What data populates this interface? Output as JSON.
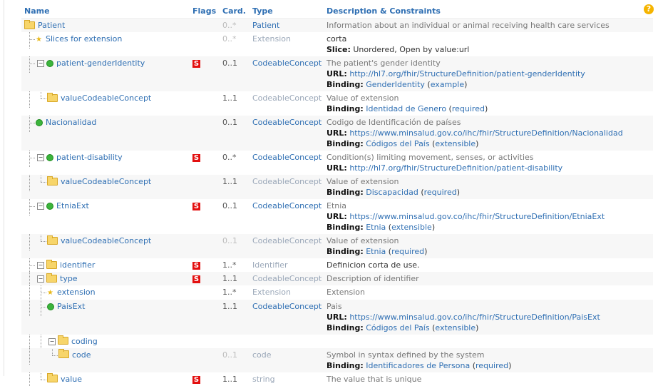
{
  "header": {
    "name": "Name",
    "flags": "Flags",
    "card": "Card.",
    "type": "Type",
    "desc": "Description & Constraints",
    "help_glyph": "?"
  },
  "rows": [
    {
      "name": "Patient",
      "flag": "",
      "card": "0..*",
      "type": "Patient",
      "desc": "Information about an individual or animal receiving health care services"
    },
    {
      "name": "Slices for extension",
      "flag": "",
      "card": "0..*",
      "type": "Extension",
      "desc": "corta",
      "slice_label": "Slice:",
      "slice_value": "Unordered, Open by value:url"
    },
    {
      "name": "patient-genderIdentity",
      "flag": "S",
      "card": "0..1",
      "type": "CodeableConcept",
      "desc": "The patient's gender identity",
      "url_label": "URL:",
      "url": "http://hl7.org/fhir/StructureDefinition/patient-genderIdentity",
      "binding_label": "Binding:",
      "binding": "GenderIdentity",
      "binding_strength": "example"
    },
    {
      "name": "valueCodeableConcept",
      "flag": "",
      "card": "1..1",
      "type": "CodeableConcept",
      "desc": "Value of extension",
      "binding_label": "Binding:",
      "binding": "Identidad de Genero",
      "binding_strength": "required"
    },
    {
      "name": "Nacionalidad",
      "flag": "",
      "card": "0..1",
      "type": "CodeableConcept",
      "desc": "Codigo de Identificación de países",
      "url_label": "URL:",
      "url": "https://www.minsalud.gov.co/ihc/fhir/StructureDefinition/Nacionalidad",
      "binding_label": "Binding:",
      "binding": "Códigos del País",
      "binding_strength": "extensible"
    },
    {
      "name": "patient-disability",
      "flag": "S",
      "card": "0..*",
      "type": "CodeableConcept",
      "desc": "Condition(s) limiting movement, senses, or activities",
      "url_label": "URL:",
      "url": "http://hl7.org/fhir/StructureDefinition/patient-disability"
    },
    {
      "name": "valueCodeableConcept",
      "flag": "",
      "card": "1..1",
      "type": "CodeableConcept",
      "desc": "Value of extension",
      "binding_label": "Binding:",
      "binding": "Discapacidad",
      "binding_strength": "required"
    },
    {
      "name": "EtniaExt",
      "flag": "S",
      "card": "0..1",
      "type": "CodeableConcept",
      "desc": "Etnia",
      "url_label": "URL:",
      "url": "https://www.minsalud.gov.co/ihc/fhir/StructureDefinition/EtniaExt",
      "binding_label": "Binding:",
      "binding": "Etnia",
      "binding_strength": "extensible"
    },
    {
      "name": "valueCodeableConcept",
      "flag": "",
      "card": "0..1",
      "type": "CodeableConcept",
      "desc": "Value of extension",
      "binding_label": "Binding:",
      "binding": "Etnia",
      "binding_strength": "required"
    },
    {
      "name": "identifier",
      "flag": "S",
      "card": "1..*",
      "type": "Identifier",
      "desc": "Definicion corta de use."
    },
    {
      "name": "type",
      "flag": "S",
      "card": "1..1",
      "type": "CodeableConcept",
      "desc": "Description of identifier"
    },
    {
      "name": "extension",
      "flag": "",
      "card": "1..*",
      "type": "Extension",
      "desc": "Extension"
    },
    {
      "name": "PaisExt",
      "flag": "",
      "card": "1..1",
      "type": "CodeableConcept",
      "desc": "Pais",
      "url_label": "URL:",
      "url": "https://www.minsalud.gov.co/ihc/fhir/StructureDefinition/PaisExt",
      "binding_label": "Binding:",
      "binding": "Códigos del País",
      "binding_strength": "extensible"
    },
    {
      "name": "coding",
      "flag": "",
      "card": "",
      "type": "",
      "desc": ""
    },
    {
      "name": "code",
      "flag": "",
      "card": "0..1",
      "type": "code",
      "desc": "Symbol in syntax defined by the system",
      "binding_label": "Binding:",
      "binding": "Identificadores de Persona",
      "binding_strength": "required"
    },
    {
      "name": "value",
      "flag": "S",
      "card": "1..1",
      "type": "string",
      "desc": "The value that is unique"
    }
  ]
}
